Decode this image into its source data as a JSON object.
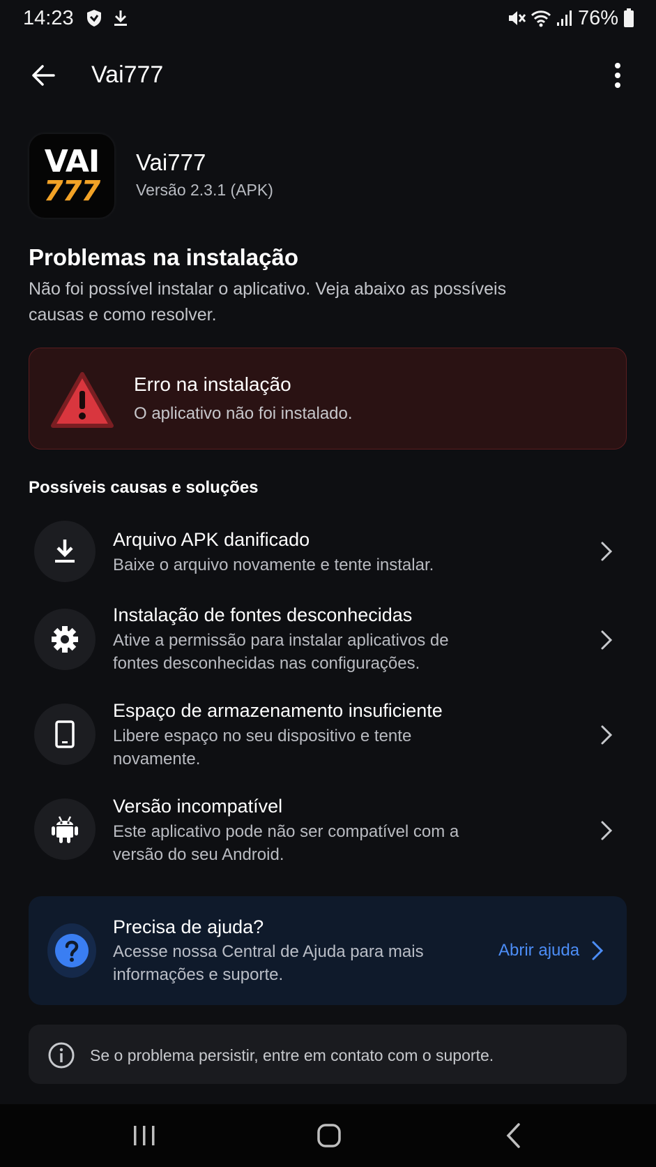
{
  "status_bar": {
    "time": "14:23",
    "battery_percent": "76%",
    "left_icons": [
      "shield-icon",
      "download-icon"
    ],
    "right_icons": [
      "mute-icon",
      "wifi-icon",
      "signal-icon",
      "battery-icon"
    ]
  },
  "app_bar": {
    "title": "Vai777",
    "back_icon": "arrow-left-icon",
    "menu_icon": "more-vertical-icon"
  },
  "app": {
    "icon_text_top": "VAI",
    "icon_text_bottom": "777",
    "name": "Vai777",
    "version": "Versão 2.3.1 (APK)"
  },
  "headline": {
    "title": "Problemas na instalação",
    "description": "Não foi possível instalar o aplicativo. Veja abaixo as possíveis causas e como resolver."
  },
  "error": {
    "title": "Erro na instalação",
    "subtitle": "O aplicativo não foi instalado.",
    "icon": "warning-triangle-icon"
  },
  "causes": {
    "section_title": "Possíveis causas e soluções",
    "items": [
      {
        "icon": "download-icon",
        "title": "Arquivo APK danificado",
        "desc": "Baixe o arquivo novamente e tente instalar."
      },
      {
        "icon": "gear-icon",
        "title": "Instalação de fontes desconhecidas",
        "desc": "Ative a permissão para instalar aplicativos de fontes desconhecidas nas configurações."
      },
      {
        "icon": "phone-icon",
        "title": "Espaço de armazenamento insuficiente",
        "desc": "Libere espaço no seu dispositivo e tente novamente."
      },
      {
        "icon": "android-icon",
        "title": "Versão incompatível",
        "desc": "Este aplicativo pode não ser compatível com a versão do seu Android."
      }
    ]
  },
  "help": {
    "title": "Precisa de ajuda?",
    "desc": "Acesse nossa Central de Ajuda para mais informações e suporte.",
    "link_label": "Abrir ajuda",
    "icon": "question-circle-icon"
  },
  "note": {
    "text": "Se o problema persistir, entre em contato com o suporte.",
    "icon": "info-icon"
  },
  "colors": {
    "background": "#0e0f12",
    "error_bg": "#2a1213",
    "error_red": "#d9363e",
    "link_blue": "#4c8df6",
    "brand_orange": "#f2a226"
  }
}
